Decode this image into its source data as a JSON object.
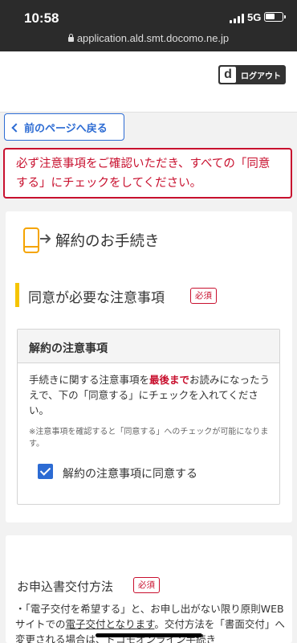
{
  "status_bar": {
    "time": "10:58",
    "network": "5G",
    "url": "application.ald.smt.docomo.ne.jp"
  },
  "header": {
    "logo_letter": "d",
    "logout_label": "ログアウト"
  },
  "nav": {
    "back_label": "前のページへ戻る"
  },
  "error": {
    "message": "必ず注意事項をご確認いただき、すべての「同意する」にチェックをしてください。"
  },
  "procedure": {
    "title": "解約のお手続き",
    "icon": "phone-transfer-icon",
    "section_title": "同意が必要な注意事項",
    "required_label": "必須",
    "notice": {
      "title": "解約の注意事項",
      "text_before": "手続きに関する注意事項を",
      "text_emphasis": "最後まで",
      "text_after": "お読みになったうえで、下の「同意する」にチェックを入れてください。",
      "note": "※注意事項を確認すると「同意する」へのチェックが可能になります。",
      "agree_label": "解約の注意事項に同意する",
      "agree_checked": true
    }
  },
  "delivery": {
    "title": "お申込書交付方法",
    "required_label": "必須",
    "text_before": "・「電子交付を希望する」と、お申し出がない限り原則WEBサイトでの",
    "text_underline": "電子交付となります",
    "text_after": "。交付方法を「書面交付」へ変更される場合は、ドコモオンライン手続き"
  },
  "colors": {
    "accent_blue": "#2c6bd3",
    "error_red": "#c8102e",
    "section_yellow": "#f5c400"
  }
}
